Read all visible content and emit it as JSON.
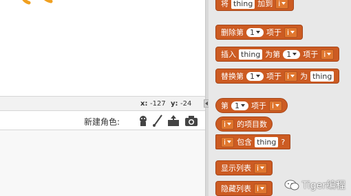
{
  "stage": {
    "coords": {
      "x_label": "x:",
      "x_value": "-127",
      "y_label": "y:",
      "y_value": "-24"
    }
  },
  "sprite_toolbar": {
    "new_sprite_label": "新建角色:",
    "icons": [
      "sprite-library-icon",
      "paint-brush-icon",
      "upload-sprite-icon",
      "camera-icon"
    ]
  },
  "palette": {
    "block_color": "#cc5b22",
    "blocks": {
      "add": {
        "pre": "将",
        "thing": "thing",
        "post": "加到",
        "list": "i"
      },
      "delete": {
        "pre": "删除第",
        "index": "1",
        "post": "项于",
        "list": "i"
      },
      "insert": {
        "pre": "插入",
        "thing": "thing",
        "mid1": "为第",
        "index": "1",
        "mid2": "项于",
        "list": "i"
      },
      "replace": {
        "pre": "替换第",
        "index": "1",
        "mid1": "项于",
        "list": "i",
        "mid2": "为",
        "thing": "thing"
      },
      "item": {
        "pre": "第",
        "index": "1",
        "post": "项于",
        "list": "i"
      },
      "length": {
        "list": "i",
        "post": "的项目数"
      },
      "contains": {
        "list": "i",
        "mid": "包含",
        "thing": "thing",
        "post": "?"
      },
      "show": {
        "pre": "显示列表",
        "list": "i"
      },
      "hide": {
        "pre": "隐藏列表",
        "list": "i"
      }
    }
  },
  "watermark": {
    "text": "Tiger编程",
    "icon": "wechat-icon"
  }
}
